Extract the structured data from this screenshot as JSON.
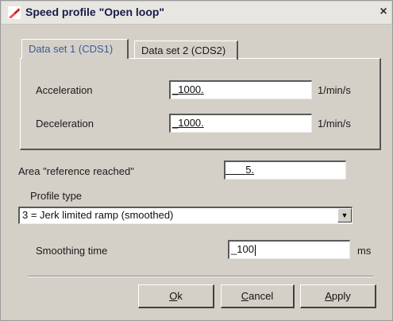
{
  "window": {
    "title": "Speed profile \"Open loop\"",
    "close_label": "×"
  },
  "tabs": [
    {
      "label": "Data set 1 (CDS1)",
      "active": true
    },
    {
      "label": "Data set 2 (CDS2)",
      "active": false
    }
  ],
  "acceleration": {
    "label": "Acceleration",
    "value": "_1000.",
    "unit": "1/min/s"
  },
  "deceleration": {
    "label": "Deceleration",
    "value": "_1000.",
    "unit": "1/min/s"
  },
  "area_reference_reached": {
    "label": "Area \"reference reached\"",
    "value": "5."
  },
  "profile_type": {
    "label": "Profile type",
    "selected": "3 = Jerk limited ramp (smoothed)"
  },
  "smoothing_time": {
    "label": "Smoothing time",
    "value": "_100",
    "unit": "ms"
  },
  "buttons": {
    "ok": {
      "accel": "O",
      "rest": "k"
    },
    "cancel": {
      "accel": "C",
      "rest": "ancel"
    },
    "apply": {
      "accel": "A",
      "rest": "pply"
    }
  },
  "colors": {
    "active_tab_text": "#3b5b9a",
    "dialog_face": "#d4d0c8"
  }
}
